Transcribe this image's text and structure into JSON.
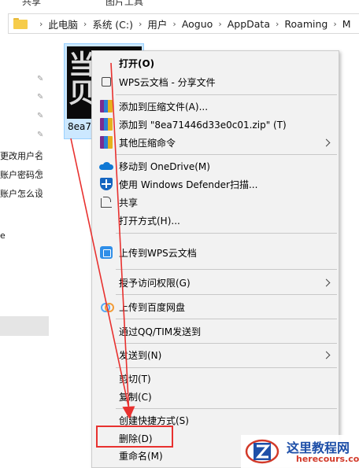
{
  "ribbon": {
    "tabs": [
      "共享",
      "图片工具"
    ]
  },
  "breadcrumb": [
    "此电脑",
    "系统 (C:)",
    "用户",
    "Aoguo",
    "AppData",
    "Roaming",
    "M"
  ],
  "nav": {
    "items": [
      "更改用户名",
      "账户密码怎",
      "账户怎么设",
      "e"
    ]
  },
  "file": {
    "name": "8ea71"
  },
  "thumb_glyph": [
    "当",
    "贝"
  ],
  "menu": {
    "open": "打开(O)",
    "wps_share": "WPS云文档 - 分享文件",
    "add_archive": "添加到压缩文件(A)...",
    "add_zip": "添加到 \"8ea71446d33e0c01.zip\" (T)",
    "other_compress": "其他压缩命令",
    "onedrive": "移动到 OneDrive(M)",
    "defender": "使用 Windows Defender扫描...",
    "share": "共享",
    "open_with": "打开方式(H)...",
    "upload_wps": "上传到WPS云文档",
    "grant_access": "授予访问权限(G)",
    "upload_baidu": "上传到百度网盘",
    "send_qq": "通过QQ/TIM发送到",
    "send_to": "发送到(N)",
    "cut": "剪切(T)",
    "copy": "复制(C)",
    "create_shortcut": "创建快捷方式(S)",
    "delete": "删除(D)",
    "rename": "重命名(M)"
  },
  "watermark": {
    "title": "这里教程网",
    "url": "herecours.com"
  },
  "colors": {
    "annotation": "#e8312f",
    "menu_bg": "#f2f2f2",
    "selection": "#cce8ff"
  }
}
